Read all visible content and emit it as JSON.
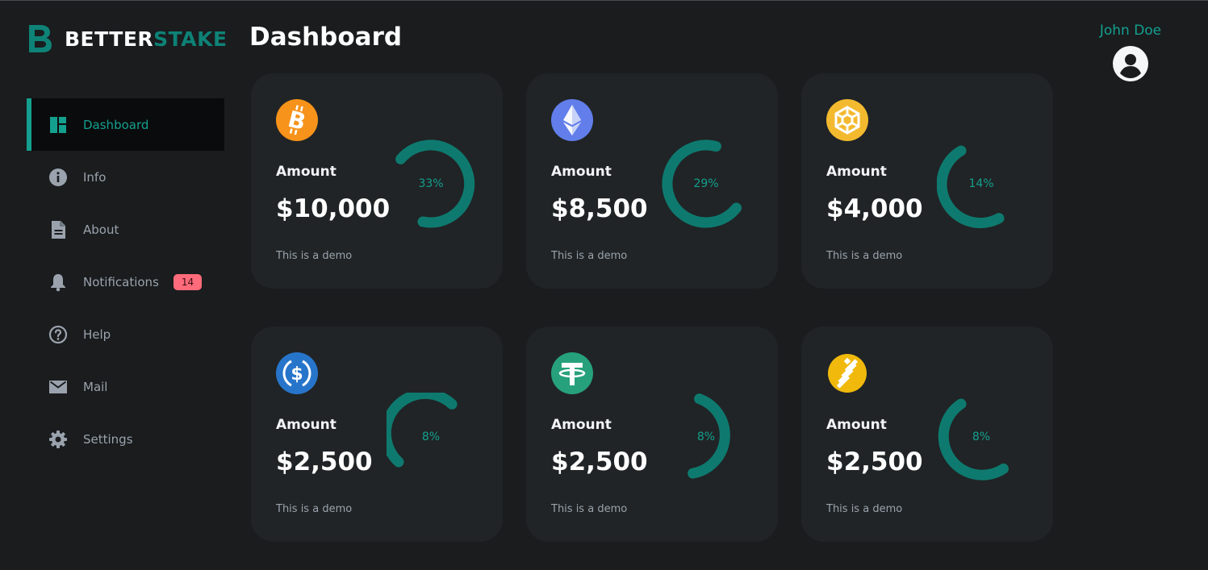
{
  "brand": {
    "part1": "BETTER",
    "part2": "STAKE"
  },
  "page_title": "Dashboard",
  "user": {
    "name": "John Doe"
  },
  "sidebar": {
    "items": [
      {
        "label": "Dashboard",
        "icon": "dashboard-icon",
        "active": true
      },
      {
        "label": "Info",
        "icon": "info-icon"
      },
      {
        "label": "About",
        "icon": "document-icon"
      },
      {
        "label": "Notifications",
        "icon": "bell-icon",
        "badge": "14"
      },
      {
        "label": "Help",
        "icon": "help-icon"
      },
      {
        "label": "Mail",
        "icon": "mail-icon"
      },
      {
        "label": "Settings",
        "icon": "gear-icon"
      }
    ]
  },
  "cards": [
    {
      "coin": "bitcoin-icon",
      "label": "Amount",
      "value": "$10,000",
      "percent": "33%",
      "note": "This is a demo"
    },
    {
      "coin": "ethereum-icon",
      "label": "Amount",
      "value": "$8,500",
      "percent": "29%",
      "note": "This is a demo"
    },
    {
      "coin": "bnb-icon",
      "label": "Amount",
      "value": "$4,000",
      "percent": "14%",
      "note": "This is a demo"
    },
    {
      "coin": "usdc-icon",
      "label": "Amount",
      "value": "$2,500",
      "percent": "8%",
      "note": "This is a demo"
    },
    {
      "coin": "tether-icon",
      "label": "Amount",
      "value": "$2,500",
      "percent": "8%",
      "note": "This is a demo"
    },
    {
      "coin": "busd-icon",
      "label": "Amount",
      "value": "$2,500",
      "percent": "8%",
      "note": "This is a demo"
    }
  ],
  "colors": {
    "accent": "#14a08e",
    "gauge": "#0e7a6f",
    "background": "#1a1c1e",
    "card": "#202426",
    "badge": "#ff6b7a",
    "bitcoin": "#f7931a",
    "ethereum": "#627eea",
    "bnb": "#f3ba2f",
    "usdc": "#2775ca",
    "tether": "#26a17b",
    "busd": "#f0b90b"
  }
}
